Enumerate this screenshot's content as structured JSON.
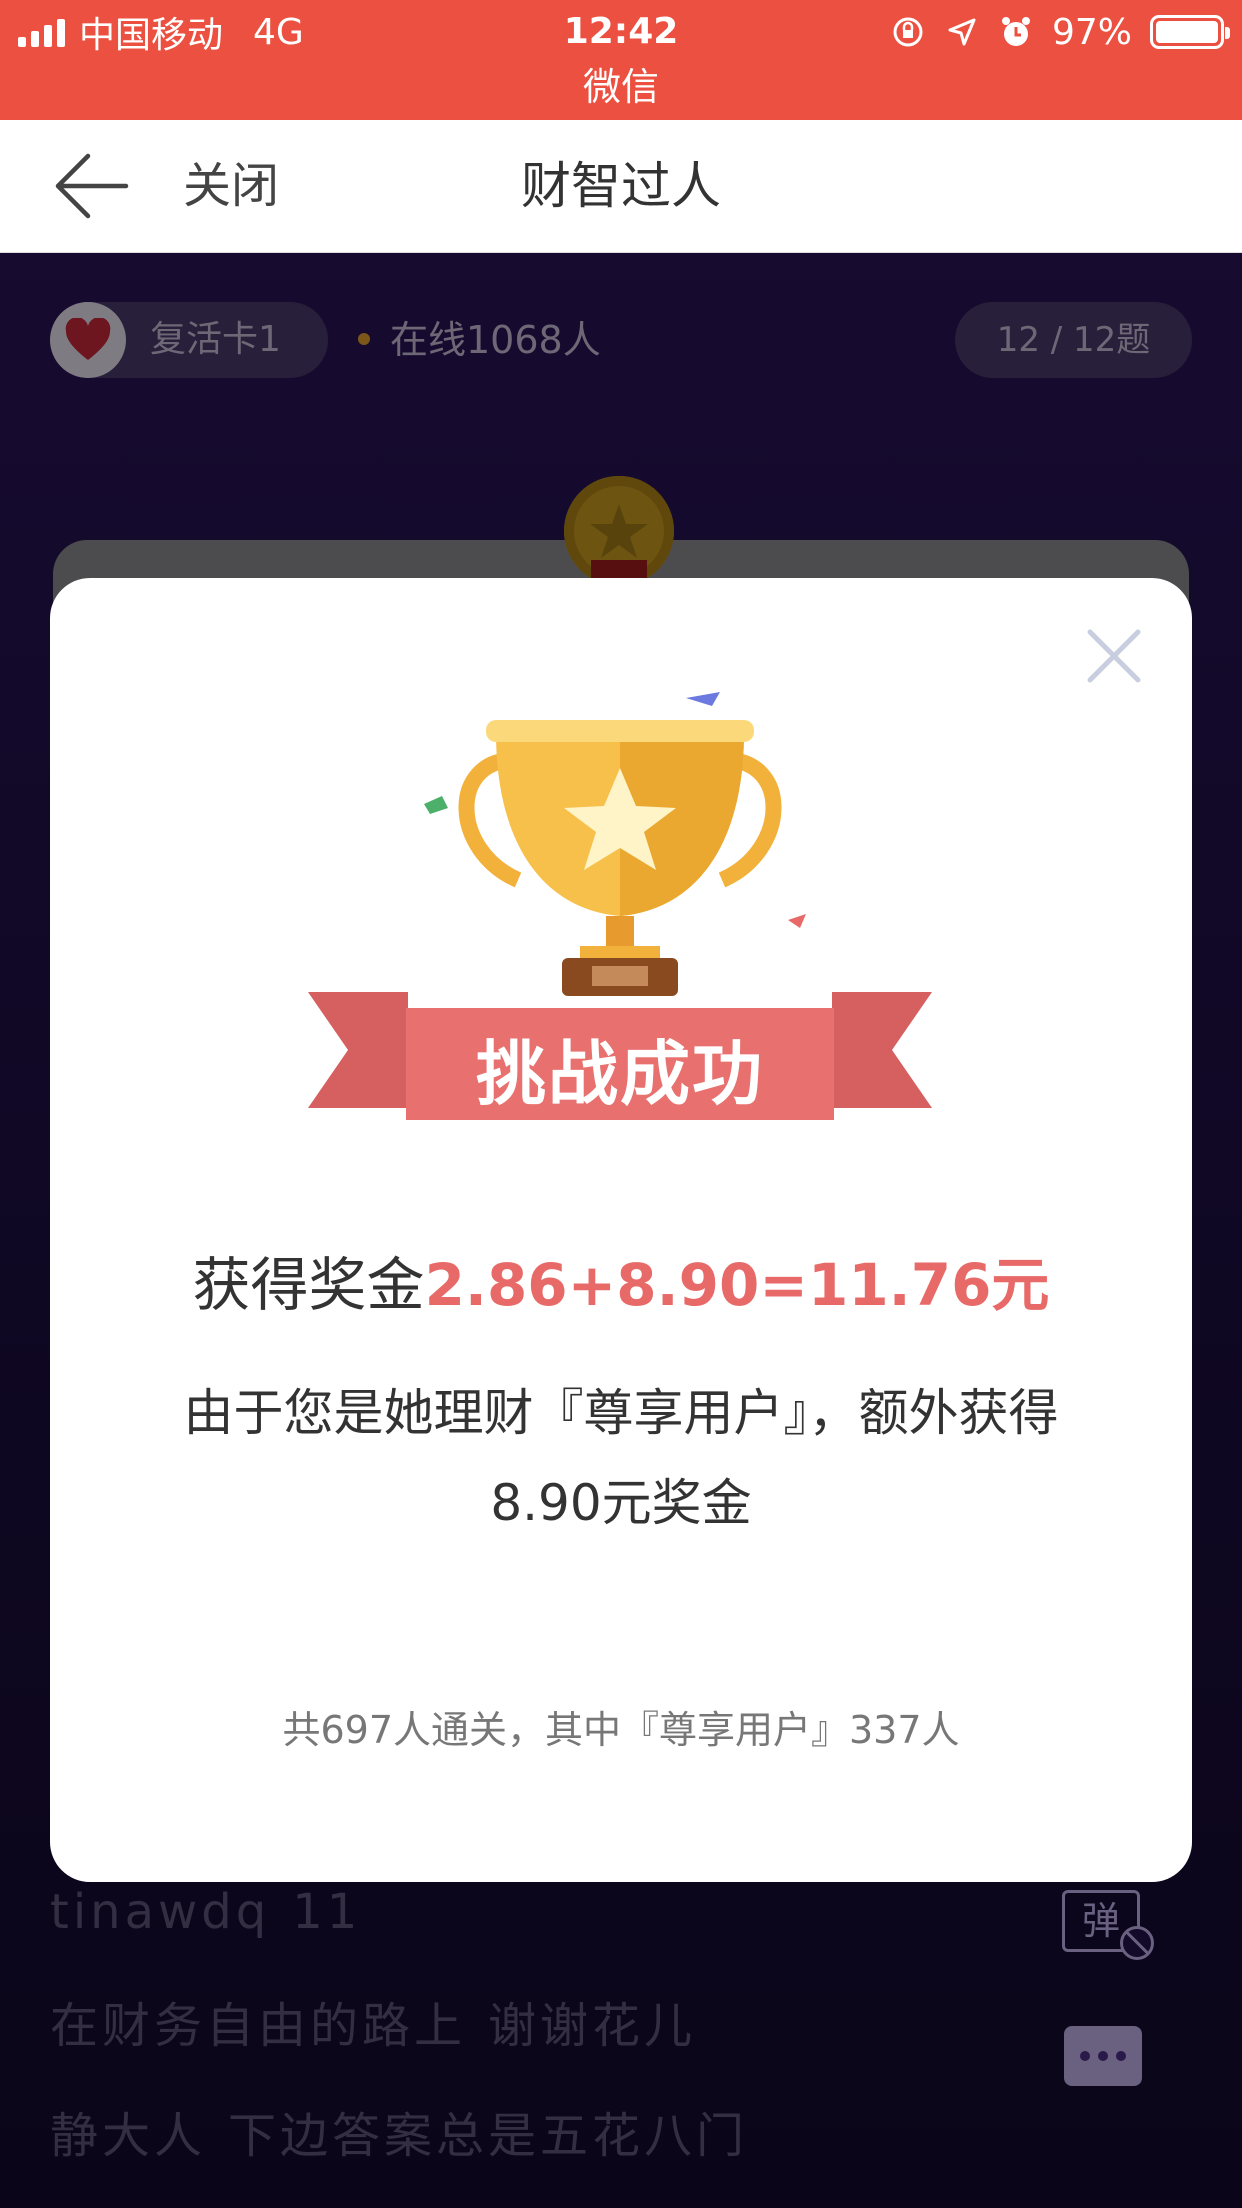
{
  "status_bar": {
    "carrier": "中国移动",
    "network": "4G",
    "time": "12:42",
    "app_name": "微信",
    "battery": "97%",
    "battery_level": 0.97,
    "color": "#ec5040"
  },
  "nav": {
    "close_label": "关闭",
    "title": "财智过人"
  },
  "game": {
    "revive_label": "复活卡1",
    "online_text": "在线1068人",
    "question_progress": "12 / 12题"
  },
  "modal": {
    "banner_text": "挑战成功",
    "reward_prefix": "获得奖金",
    "reward_amount": "2.86+8.90=11.76元",
    "description": "由于您是她理财『尊享用户』，额外获得8.90元奖金",
    "stats": "共697人通关，其中『尊享用户』337人",
    "accent_color": "#e86a68"
  },
  "chat": [
    {
      "user": "tinawdq",
      "message": "11"
    },
    {
      "user": "在财务自由的路上",
      "message": "谢谢花儿"
    },
    {
      "user": "静大人",
      "message": "下边答案总是五花八门"
    }
  ],
  "danmu_label": "弹"
}
